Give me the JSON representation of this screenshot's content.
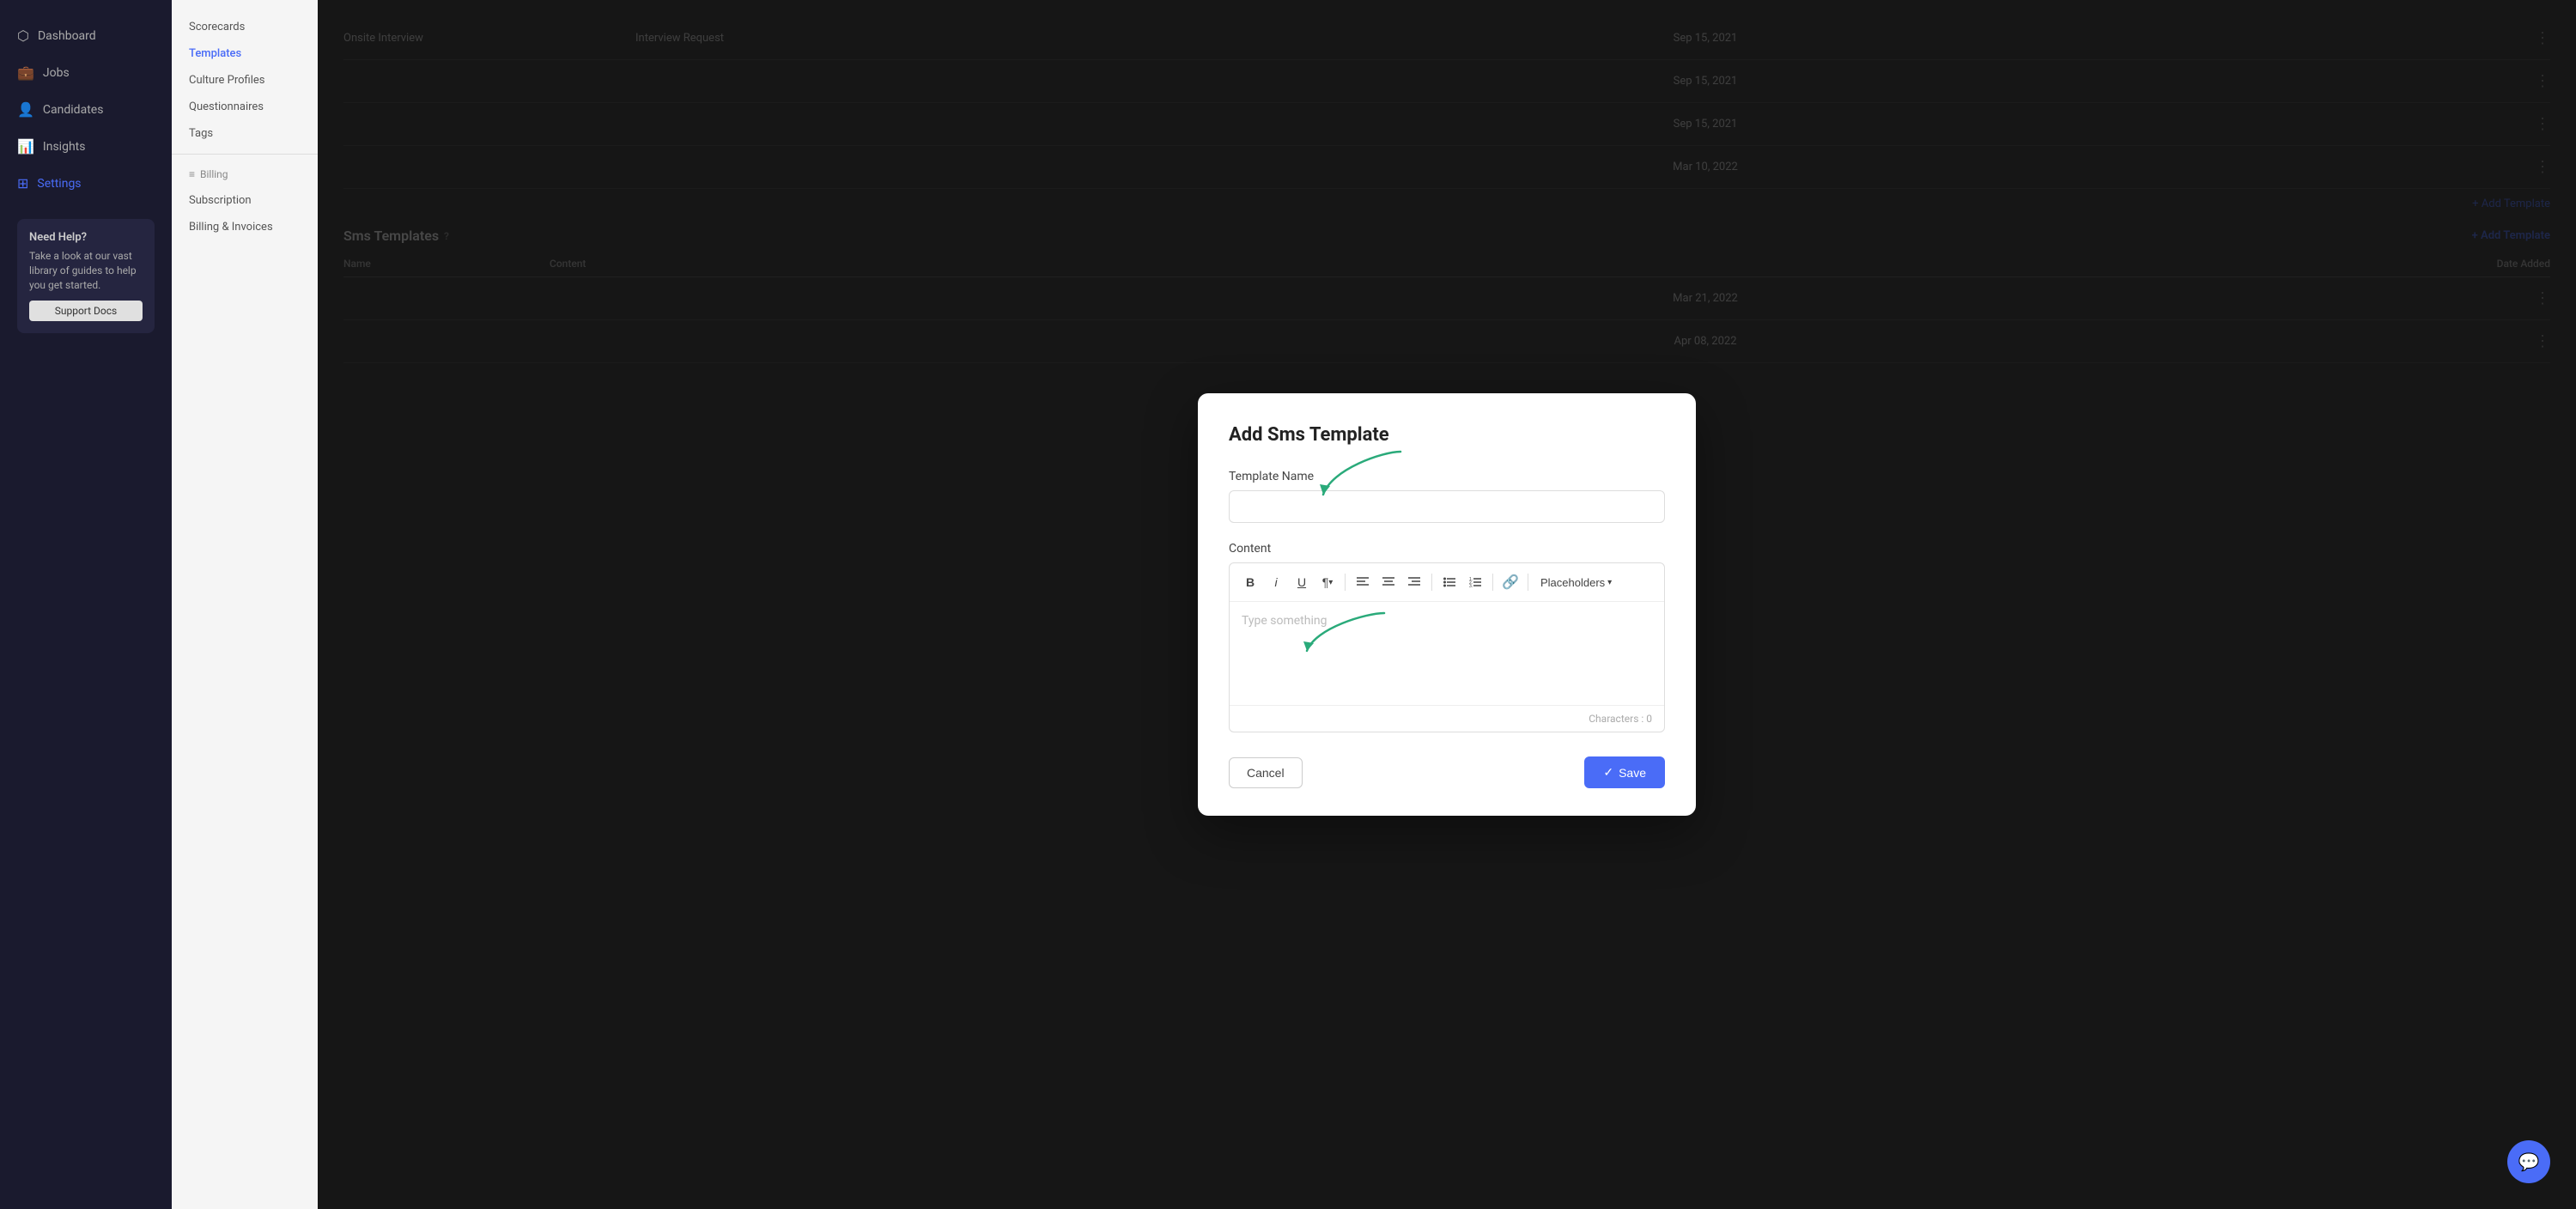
{
  "sidebar": {
    "items": [
      {
        "label": "Dashboard",
        "icon": "⬡",
        "active": false
      },
      {
        "label": "Jobs",
        "icon": "💼",
        "active": false
      },
      {
        "label": "Candidates",
        "icon": "👤",
        "active": false
      },
      {
        "label": "Insights",
        "icon": "📊",
        "active": false
      },
      {
        "label": "Settings",
        "icon": "⊞",
        "active": true
      }
    ],
    "help": {
      "title": "Need Help?",
      "text": "Take a look at our vast library of guides to help you get started.",
      "link_label": "Support Docs"
    }
  },
  "sub_sidebar": {
    "sections": [
      {
        "label": "Scorecards",
        "active": false
      },
      {
        "label": "Templates",
        "active": true
      },
      {
        "label": "Culture Profiles",
        "active": false
      },
      {
        "label": "Questionnaires",
        "active": false
      },
      {
        "label": "Tags",
        "active": false
      }
    ],
    "billing_section": {
      "label": "Billing",
      "items": [
        {
          "label": "Subscription",
          "active": false
        },
        {
          "label": "Billing & Invoices",
          "active": false
        }
      ]
    }
  },
  "background": {
    "rows": [
      {
        "name": "Onsite Interview",
        "type": "Interview Request",
        "date": "Sep 15, 2021"
      },
      {
        "name": "",
        "type": "",
        "date": "Sep 15, 2021"
      },
      {
        "name": "",
        "type": "",
        "date": "Sep 15, 2021"
      },
      {
        "name": "",
        "type": "",
        "date": "Mar 10, 2022"
      }
    ],
    "add_template_label": "+ Add Template",
    "sms_section_label": "Sms Templates",
    "sms_add_label": "+ Add Template",
    "table_headers": {
      "name": "Name",
      "content": "Content",
      "date": "Date Added"
    },
    "sms_rows": [
      {
        "date": "Mar 21, 2022"
      },
      {
        "date": "Apr 08, 2022"
      }
    ]
  },
  "modal": {
    "title": "Add Sms Template",
    "template_name_label": "Template Name",
    "template_name_placeholder": "",
    "content_label": "Content",
    "editor": {
      "placeholder": "Type something",
      "characters_label": "Characters : 0"
    },
    "toolbar": {
      "bold": "B",
      "italic": "i",
      "underline": "U",
      "paragraph": "¶",
      "align_left": "≡",
      "align_center": "≡",
      "align_right": "≡",
      "bullet_list": "≔",
      "ordered_list": "≔",
      "link": "🔗",
      "placeholders": "Placeholders"
    },
    "cancel_label": "Cancel",
    "save_label": "Save"
  }
}
